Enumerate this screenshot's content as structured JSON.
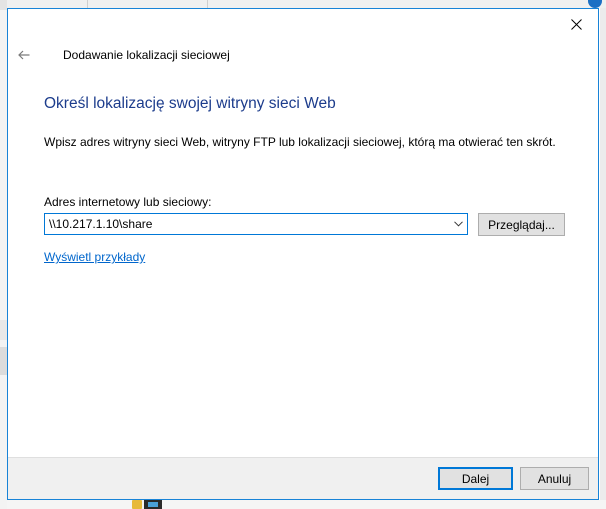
{
  "dialog": {
    "wizard_title": "Dodawanie lokalizacji sieciowej",
    "main_instruction": "Określ lokalizację swojej witryny sieci Web",
    "description": "Wpisz adres witryny sieci Web, witryny FTP lub lokalizacji sieciowej, którą ma otwierać ten skrót.",
    "address_label": "Adres internetowy lub sieciowy:",
    "address_value": "\\\\10.217.1.10\\share",
    "browse_label": "Przeglądaj...",
    "examples_link": "Wyświetl przykłady",
    "next_label": "Dalej",
    "cancel_label": "Anuluj"
  },
  "icons": {
    "back": "back-arrow-icon",
    "close": "close-icon",
    "dropdown": "chevron-down-icon"
  },
  "colors": {
    "accent": "#0078d7",
    "window_border": "#1883d7",
    "instruction_text": "#1c3c8c",
    "link": "#0066cc",
    "footer_bg": "#f0f0f0"
  }
}
